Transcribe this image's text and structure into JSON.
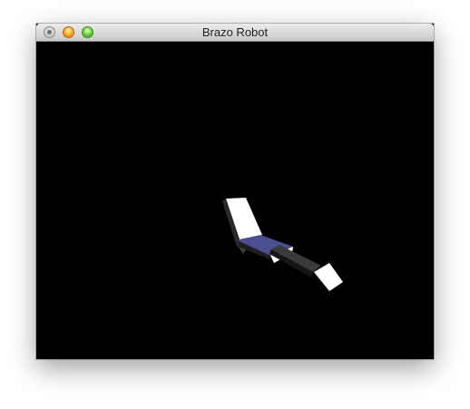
{
  "window": {
    "title": "Brazo Robot"
  },
  "icons": {
    "close": "close-icon",
    "minimize": "minimize-icon",
    "zoom": "zoom-icon"
  },
  "colors": {
    "titlebar": "#d9d9d9",
    "viewport_background": "#000000",
    "arm_light": "#ffffff",
    "arm_dark": "#2a2a2a",
    "joint_blue": "#4b4f8f"
  }
}
